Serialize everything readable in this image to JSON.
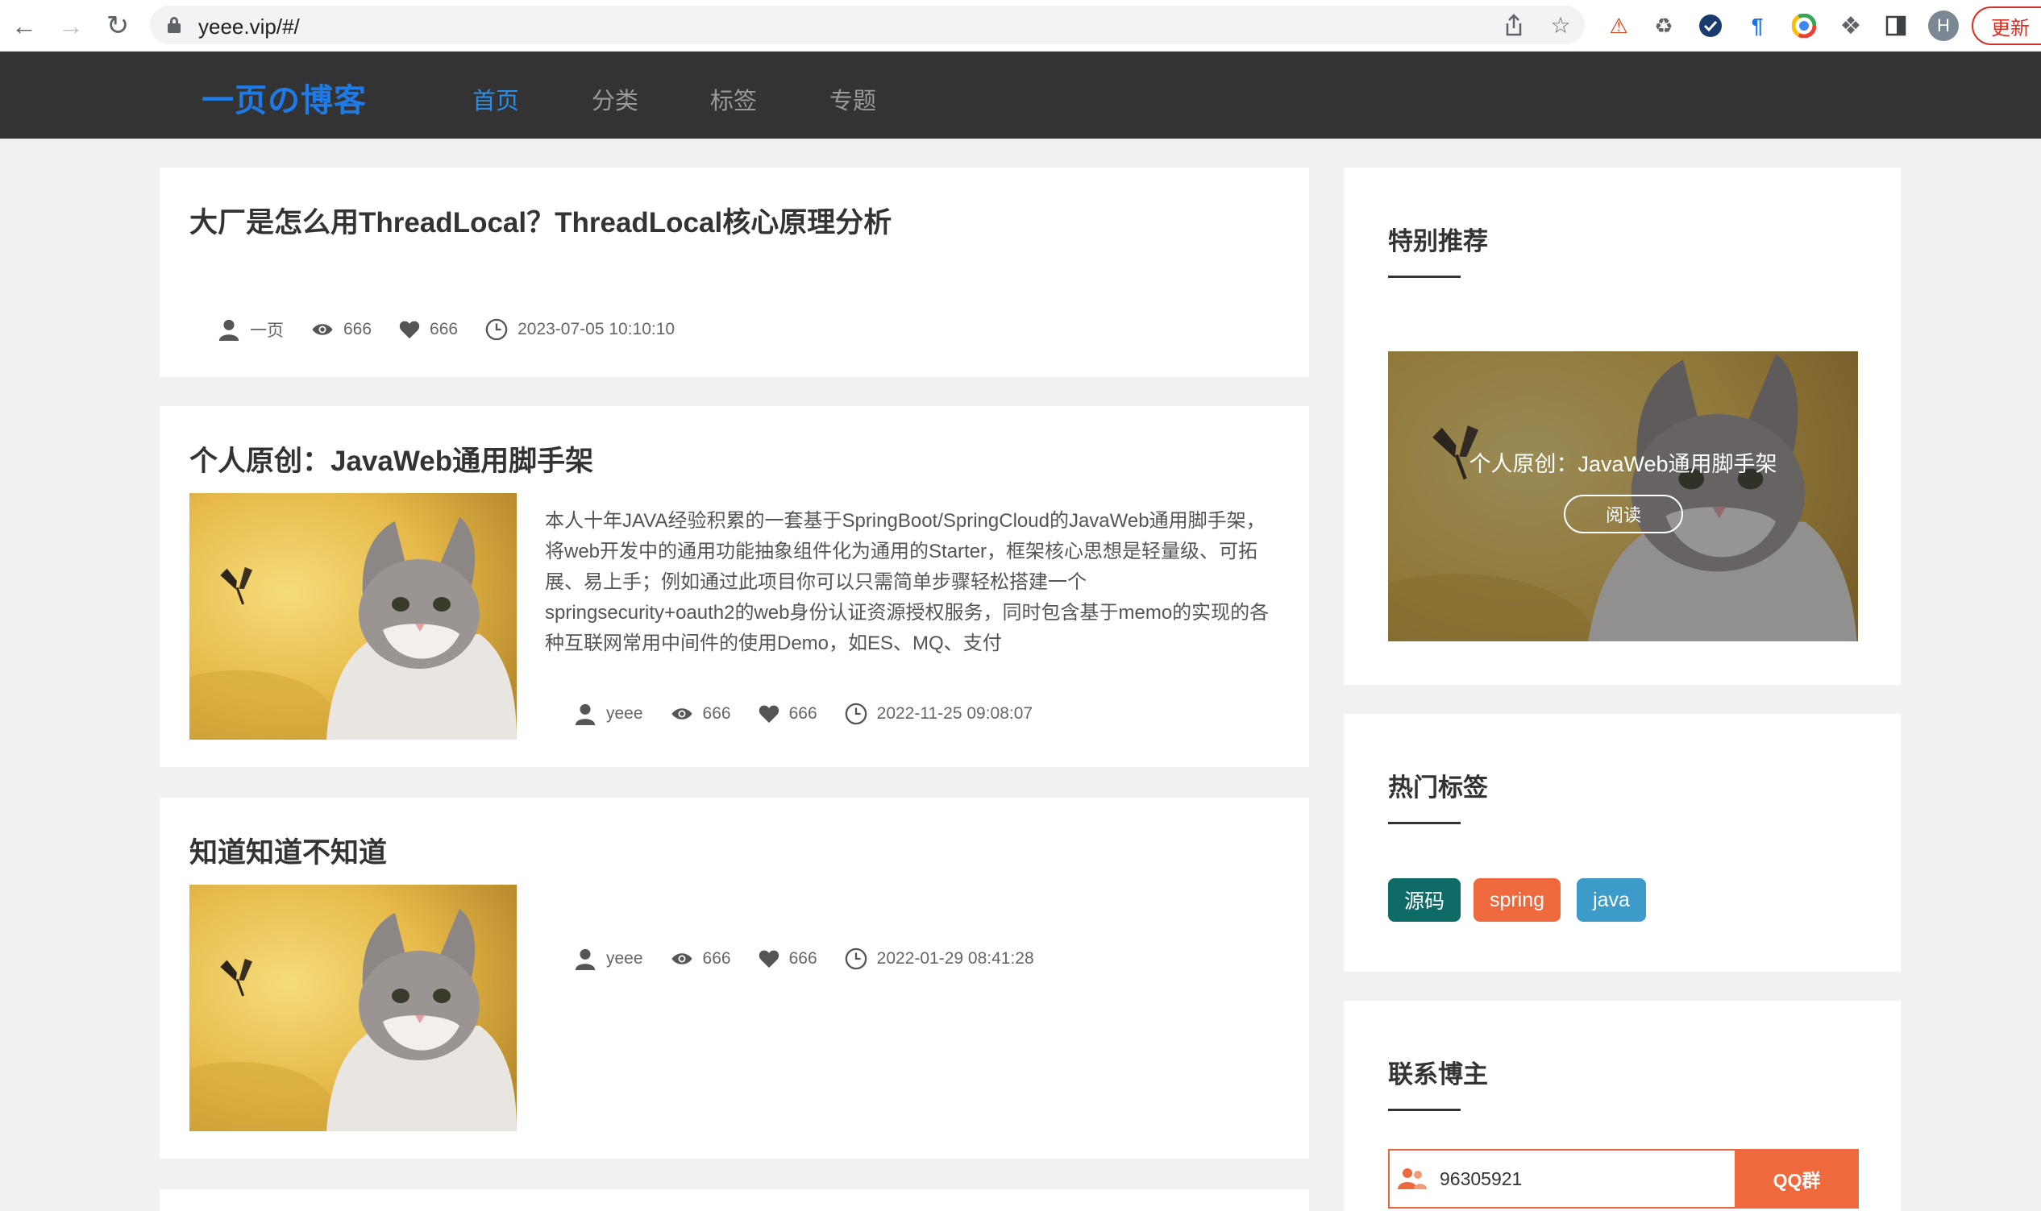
{
  "browser": {
    "url": "yeee.vip/#/",
    "profile_initial": "H",
    "update_label": "更新"
  },
  "site": {
    "logo": "一页の博客",
    "menu": [
      {
        "label": "首页",
        "active": true
      },
      {
        "label": "分类",
        "active": false
      },
      {
        "label": "标签",
        "active": false
      },
      {
        "label": "专题",
        "active": false
      }
    ]
  },
  "posts": [
    {
      "title": "大厂是怎么用ThreadLocal？ThreadLocal核心原理分析",
      "author": "一页",
      "views": "666",
      "likes": "666",
      "date": "2023-07-05 10:10:10"
    },
    {
      "title": "个人原创：JavaWeb通用脚手架",
      "summary": "本人十年JAVA经验积累的一套基于SpringBoot/SpringCloud的JavaWeb通用脚手架，将web开发中的通用功能抽象组件化为通用的Starter，框架核心思想是轻量级、可拓展、易上手；例如通过此项目你可以只需简单步骤轻松搭建一个springsecurity+oauth2的web身份认证资源授权服务，同时包含基于memo的实现的各种互联网常用中间件的使用Demo，如ES、MQ、支付",
      "author": "yeee",
      "views": "666",
      "likes": "666",
      "date": "2022-11-25 09:08:07"
    },
    {
      "title": "知道知道不知道",
      "author": "yeee",
      "views": "666",
      "likes": "666",
      "date": "2022-01-29 08:41:28"
    }
  ],
  "sidebar": {
    "recommend": {
      "heading": "特别推荐",
      "title": "个人原创：JavaWeb通用脚手架",
      "button": "阅读"
    },
    "tags": {
      "heading": "热门标签",
      "items": [
        {
          "label": "源码",
          "color": "#0f6b66"
        },
        {
          "label": "spring",
          "color": "#ee6a3e"
        },
        {
          "label": "java",
          "color": "#3c9bc9"
        }
      ]
    },
    "contact": {
      "heading": "联系博主",
      "qq_number": "96305921",
      "button": "QQ群"
    }
  }
}
